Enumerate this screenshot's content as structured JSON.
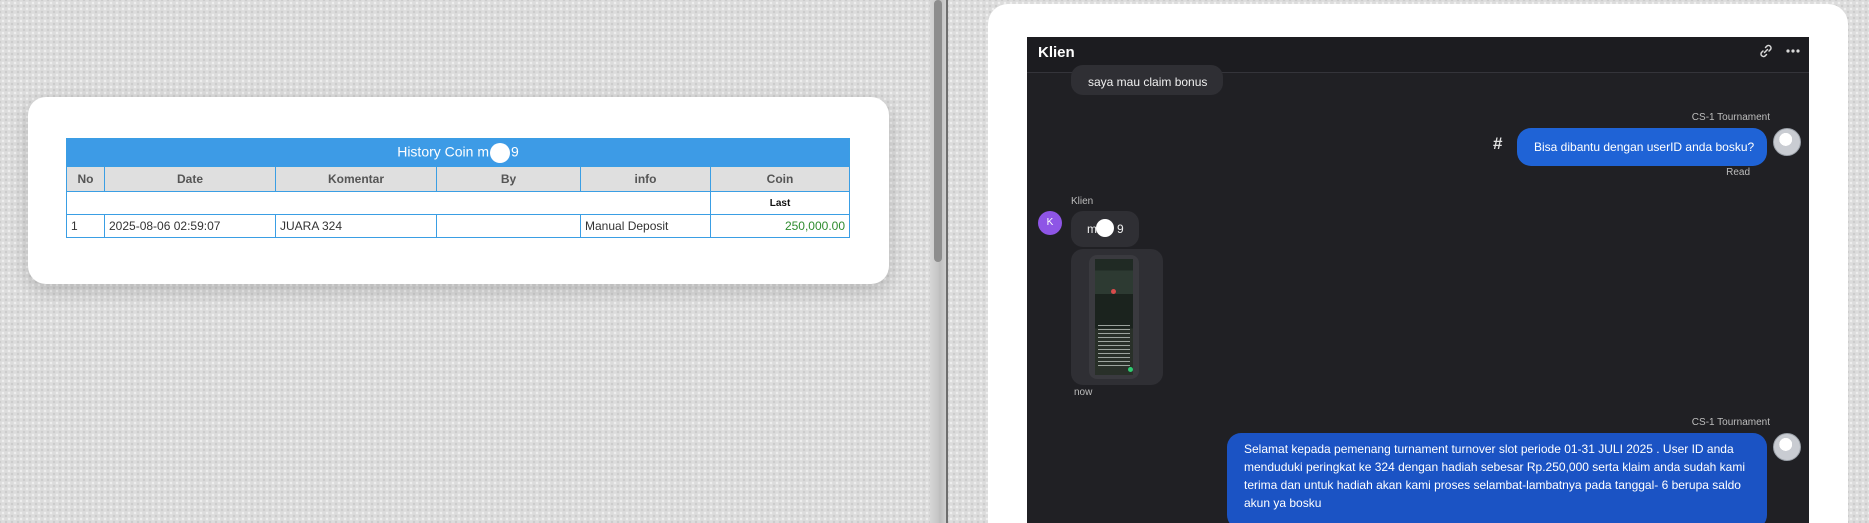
{
  "history": {
    "title_left": "History Coin m",
    "title_right": "9",
    "columns": [
      "No",
      "Date",
      "Komentar",
      "By",
      "info",
      "Coin"
    ],
    "subheader_coin": "Last",
    "rows": [
      {
        "no": "1",
        "date": "2025-08-06 02:59:07",
        "komentar": "JUARA 324",
        "by": "",
        "info": "Manual Deposit",
        "coin": "250,000.00"
      }
    ]
  },
  "chat": {
    "title": "Klien",
    "icons": {
      "link": "link-icon",
      "more": "more-icon"
    },
    "messages": [
      {
        "text": "saya mau claim bonus"
      },
      {
        "sender": "CS-1 Tournament",
        "text": "Bisa dibantu dengan userID anda bosku?",
        "status": "Read",
        "hash": "#"
      },
      {
        "sender": "Klien",
        "avatar": "K",
        "text_left": "m",
        "text_right": "9",
        "time": "now"
      },
      {
        "sender": "CS-1 Tournament",
        "text": "Selamat kepada pemenang turnament turnover slot periode 01-31 JULI 2025 . User ID anda menduduki peringkat ke 324 dengan hadiah sebesar Rp.250,000 serta klaim anda sudah kami terima dan untuk hadiah akan kami proses selambat-lambatnya pada tanggal- 6 berupa saldo akun ya bosku"
      }
    ]
  },
  "colors": {
    "accent_blue": "#3d9be6",
    "bubble_blue": "#1f63d6",
    "chat_bg": "#202024",
    "coin_green": "#2e8b2e"
  }
}
